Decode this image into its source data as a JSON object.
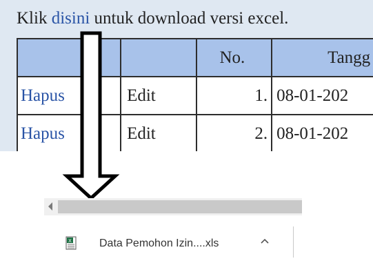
{
  "page": {
    "intro_prefix": "Klik ",
    "intro_link": "disini",
    "intro_suffix": " untuk download versi excel."
  },
  "table": {
    "headers": [
      "",
      "",
      "No.",
      "Tangg"
    ],
    "rows": [
      {
        "hapus": "Hapus",
        "edit": "Edit",
        "no": "1.",
        "tanggal": "08-01-202"
      },
      {
        "hapus": "Hapus",
        "edit": "Edit",
        "no": "2.",
        "tanggal": "08-01-202"
      }
    ]
  },
  "download_shelf": {
    "file_name": "Data Pemohon Izin....xls",
    "file_icon": "excel-file-icon",
    "toggle_icon": "chevron-up-icon"
  },
  "colors": {
    "link": "#2a54a6",
    "header_bg": "#a8c2ea",
    "page_bg": "#dfe8f2"
  }
}
